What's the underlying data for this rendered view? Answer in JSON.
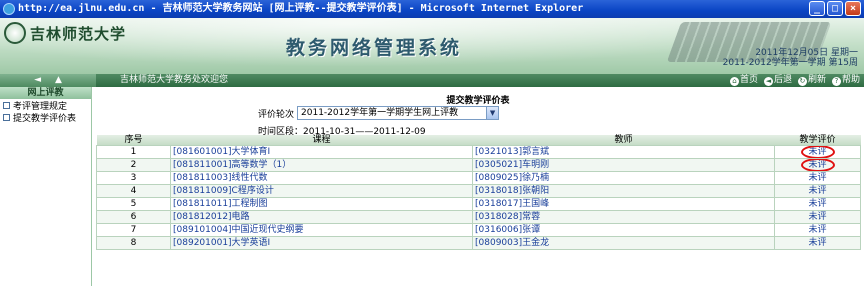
{
  "window": {
    "title": "http://ea.jlnu.edu.cn - 吉林师范大学教务网站 [网上评教--提交教学评价表] - Microsoft Internet Explorer",
    "buttons": [
      "_",
      "□",
      "×"
    ]
  },
  "banner": {
    "university": "吉林师范大学",
    "system_title": "教务网络管理系统",
    "date_line": "2011年12月05日 星期一",
    "term_line": "2011-2012学年第一学期 第15周"
  },
  "navbar": {
    "back_arrow": "◄",
    "up_arrow": "▲",
    "welcome": "吉林师范大学教务处欢迎您",
    "links": [
      {
        "icon": "home-icon",
        "glyph": "⌂",
        "label": "首页"
      },
      {
        "icon": "back-icon",
        "glyph": "◄",
        "label": "后退"
      },
      {
        "icon": "refresh-icon",
        "glyph": "↻",
        "label": "刷新"
      },
      {
        "icon": "help-icon",
        "glyph": "?",
        "label": "帮助"
      }
    ]
  },
  "sidebar": {
    "header": "网上评教",
    "items": [
      {
        "label": "考评管理规定"
      },
      {
        "label": "提交教学评价表"
      }
    ]
  },
  "main": {
    "title": "提交教学评价表",
    "round_label": "评价轮次",
    "round_value": "2011-2012学年第一学期学生网上评教",
    "interval_label": "时间区段：",
    "interval_value": "2011-10-31——2011-12-09",
    "columns": {
      "no": "序号",
      "course": "课程",
      "teacher": "教师",
      "eval": "教学评价"
    },
    "rows": [
      {
        "no": "1",
        "course": "[081601001]大学体育Ⅰ",
        "teacher": "[0321013]郭言斌",
        "status": "未评",
        "circled": true
      },
      {
        "no": "2",
        "course": "[081811001]高等数学（1）",
        "teacher": "[0305021]车明刚",
        "status": "未评",
        "circled": true
      },
      {
        "no": "3",
        "course": "[081811003]线性代数",
        "teacher": "[0809025]徐乃楠",
        "status": "未评",
        "circled": false
      },
      {
        "no": "4",
        "course": "[081811009]C程序设计",
        "teacher": "[0318018]张朝阳",
        "status": "未评",
        "circled": false
      },
      {
        "no": "5",
        "course": "[081811011]工程制图",
        "teacher": "[0318017]王国峰",
        "status": "未评",
        "circled": false
      },
      {
        "no": "6",
        "course": "[081812012]电路",
        "teacher": "[0318028]常蓉",
        "status": "未评",
        "circled": false
      },
      {
        "no": "7",
        "course": "[089101004]中国近现代史纲要",
        "teacher": "[0316006]张谭",
        "status": "未评",
        "circled": false
      },
      {
        "no": "8",
        "course": "[089201001]大学英语Ⅰ",
        "teacher": "[0809003]王金龙",
        "status": "未评",
        "circled": false
      }
    ]
  },
  "colors": {
    "titlebar": "#0a44c4",
    "nav_green": "#2e6b42",
    "link_blue": "#1a3f9a",
    "annotation_red": "#e01010"
  }
}
